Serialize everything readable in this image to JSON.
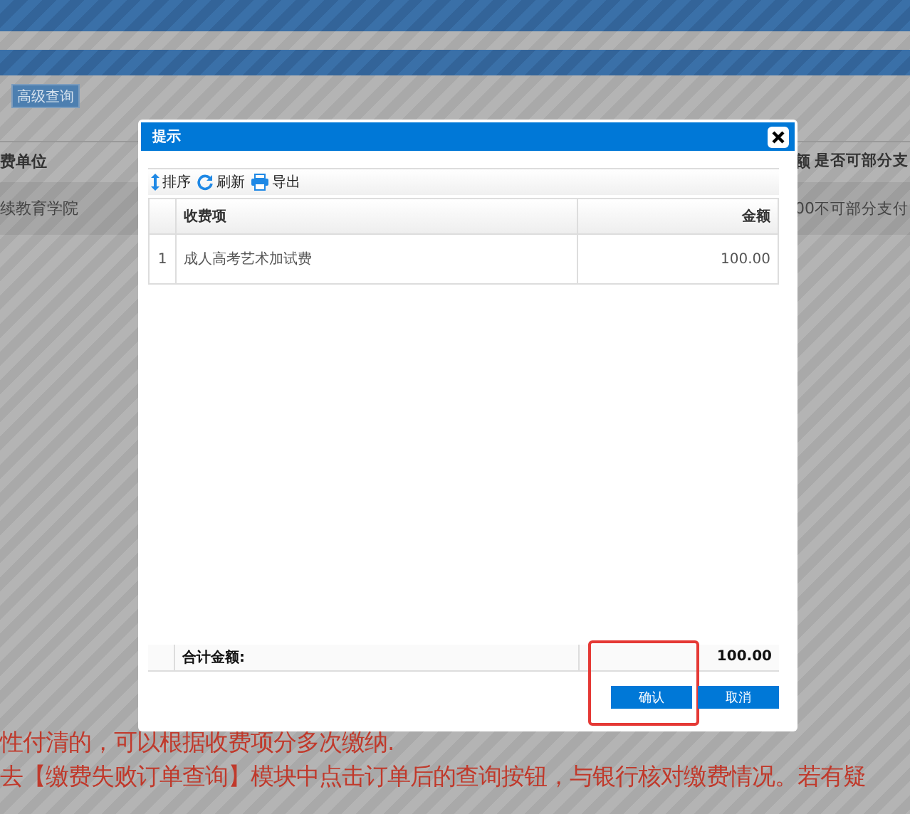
{
  "background_page": {
    "toolbar_buttons": [
      "高级查询"
    ],
    "table": {
      "columns": [
        "费单位",
        "额",
        "是否可部分支"
      ],
      "rows": [
        [
          "续教育学院",
          "00",
          "不可部分支付"
        ]
      ]
    },
    "notes": [
      "性付清的，可以根据收费项分多次缴纳.",
      "去【缴费失败订单查询】模块中点击订单后的查询按钮，与银行核对缴费情况。若有疑"
    ]
  },
  "dialog": {
    "title": "提示",
    "toolbar": [
      {
        "label": "排序",
        "kind": "sort"
      },
      {
        "label": "刷新",
        "kind": "refresh"
      },
      {
        "label": "导出",
        "kind": "print"
      }
    ],
    "grid": {
      "columns": [
        "收费项",
        "金额"
      ],
      "rows": [
        {
          "index": "1",
          "item": "成人高考艺术加试费",
          "amount": "100.00"
        }
      ],
      "footer": {
        "label": "合计金额:",
        "amount": "100.00"
      }
    },
    "buttons": [
      {
        "label": "确认",
        "highlighted": true
      },
      {
        "label": "取消",
        "highlighted": false
      }
    ]
  }
}
